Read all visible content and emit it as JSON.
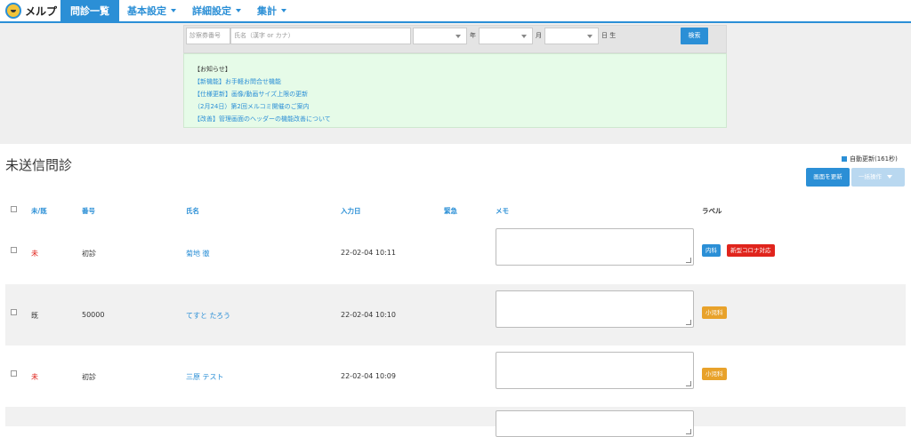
{
  "app": {
    "name": "メルプ"
  },
  "nav": [
    {
      "label": "問診一覧",
      "active": true,
      "dropdown": false
    },
    {
      "label": "基本設定",
      "active": false,
      "dropdown": true
    },
    {
      "label": "詳細設定",
      "active": false,
      "dropdown": true
    },
    {
      "label": "集計",
      "active": false,
      "dropdown": true
    }
  ],
  "search": {
    "card_placeholder": "診察券番号",
    "name_placeholder": "氏名（漢字 or カナ）",
    "year_label": "年",
    "month_label": "月",
    "day_label": "日 生",
    "button": "検索"
  },
  "notice": {
    "heading": "【お知らせ】",
    "items": [
      "【新機能】お手軽お問合せ機能",
      "【仕様更新】画像/動画サイズ上限の更新",
      "（2月24日）第2回メルコミ開催のご案内",
      "【改善】管理画面のヘッダーの機能改善について"
    ]
  },
  "page": {
    "title": "未送信問診",
    "auto_refresh": "自動更新(161秒)",
    "refresh_button": "画面を更新",
    "bulk_button": "一括操作"
  },
  "table": {
    "headers": {
      "status": "未/既",
      "number": "番号",
      "name": "氏名",
      "date": "入力日",
      "urgent": "緊急",
      "memo": "メモ",
      "label": "ラベル"
    },
    "rows": [
      {
        "status": "未",
        "number": "初診",
        "name": "菊地 徹",
        "date": "22-02-04 10:11",
        "labels": [
          "内科",
          "新型コロナ対応"
        ]
      },
      {
        "status": "既",
        "number": "50000",
        "name": "てすと たろう",
        "date": "22-02-04 10:10",
        "labels": [
          "小児科"
        ]
      },
      {
        "status": "未",
        "number": "初診",
        "name": "三原 テスト",
        "date": "22-02-04 10:09",
        "labels": [
          "小児科"
        ]
      }
    ]
  },
  "colors": {
    "accent": "#2b8fd6",
    "unread": "#e0241c",
    "label_orange": "#e8a22b",
    "notice_bg": "#e6fbe8"
  }
}
